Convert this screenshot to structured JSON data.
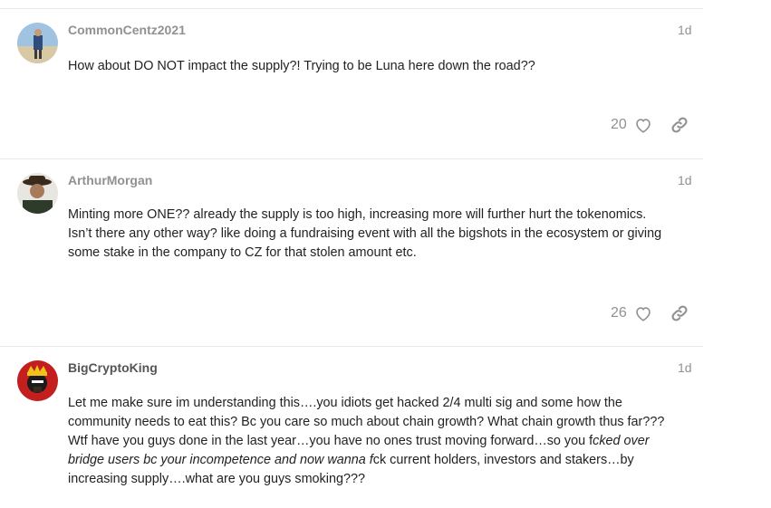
{
  "posts": [
    {
      "username": "CommonCentz2021",
      "date": "1d",
      "body": [
        "How about DO NOT impact the supply?! Trying to be Luna here down the road??"
      ],
      "likes": "20"
    },
    {
      "username": "ArthurMorgan",
      "date": "1d",
      "body": [
        "Minting more ONE?? already the supply is too high, increasing more will further hurt the tokenomics.",
        "Isn’t there any other way? like doing a fundraising event with all the bigshots in the ecosystem or giving",
        "some stake in the company to CZ for that stolen amount etc."
      ],
      "likes": "26"
    },
    {
      "username": "BigCryptoKing",
      "date": "1d",
      "body_parts": {
        "p1": "Let me make sure im understanding this….you idiots get hacked 2/4 multi sig and some how the community needs to eat this? Bc you care so much about chain growth? What chain growth thus far??? Wtf have you guys done in the last year…you have no ones trust moving forward…so you f",
        "em": "cked over bridge users bc your incompetence and now wanna f",
        "p2": "ck current holders, investors and stakers…by increasing supply….what are you guys smoking???"
      }
    }
  ],
  "icons": {
    "like": "heart-outline-icon",
    "share": "link-icon"
  },
  "colors": {
    "meta": "#919191",
    "text": "#222222",
    "divider": "#e9e9e9"
  }
}
